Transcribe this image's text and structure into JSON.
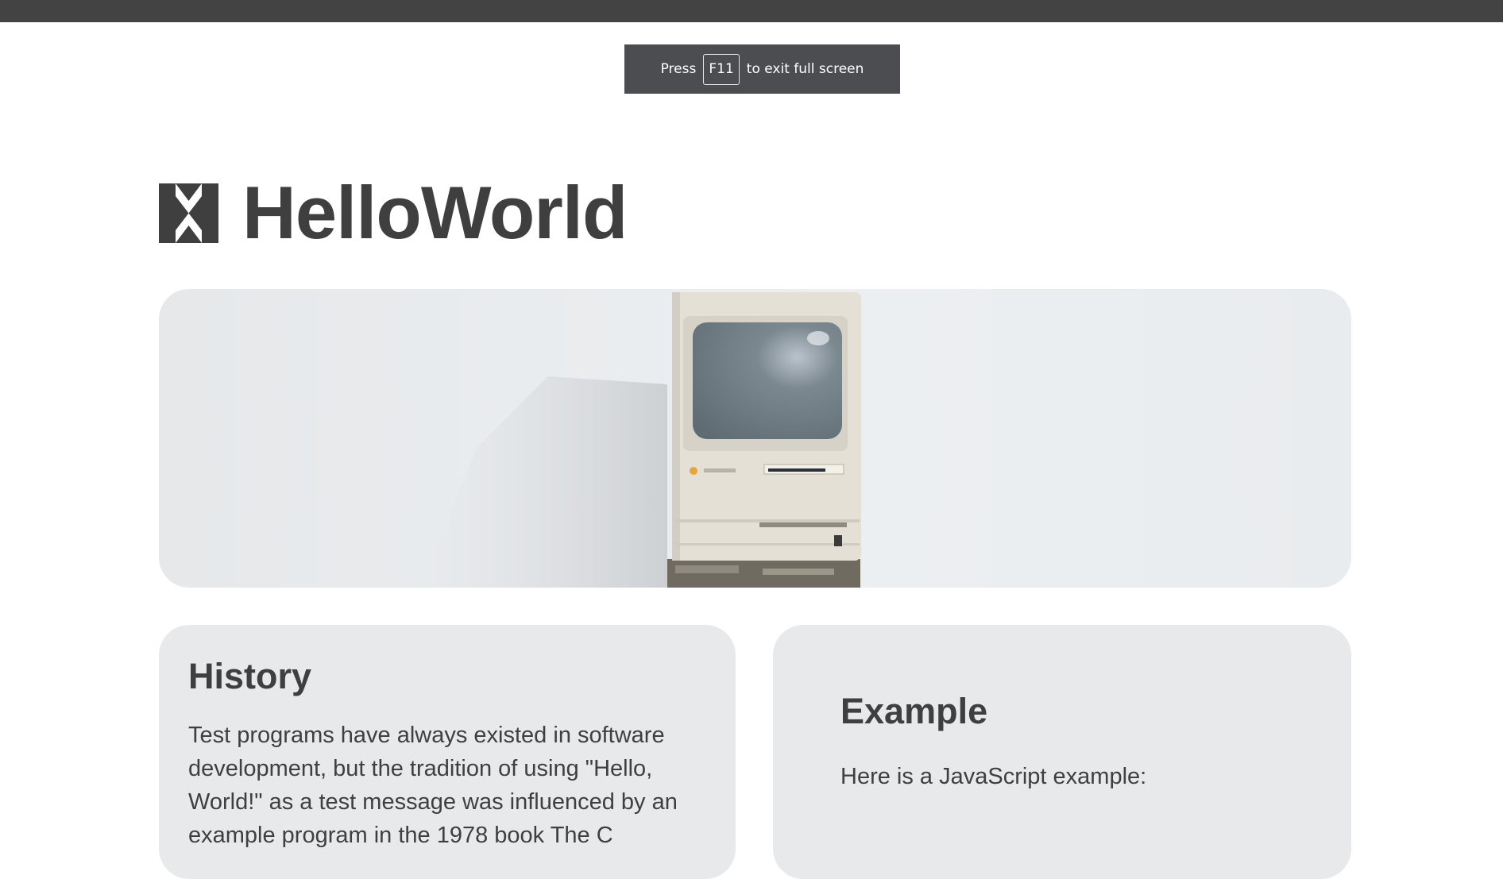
{
  "fullscreen_notice": {
    "prefix": "Press",
    "key": "F11",
    "suffix": "to exit full screen"
  },
  "brand": {
    "logo_icon": "helloworld-logo-icon",
    "name": "HelloWorld"
  },
  "hero": {
    "image": "vintage-computer-photo"
  },
  "cards": {
    "history": {
      "title": "History",
      "body": "Test programs have always existed in software development, but the tradition of using \"Hello, World!\" as a test message was influenced by an example program in the 1978 book The C"
    },
    "example": {
      "title": "Example",
      "body": "Here is a JavaScript example:"
    }
  },
  "colors": {
    "text": "#3f3f40",
    "card_bg": "#e8e9eb",
    "topbar": "#434344",
    "toast_bg": "#4b4d51"
  }
}
